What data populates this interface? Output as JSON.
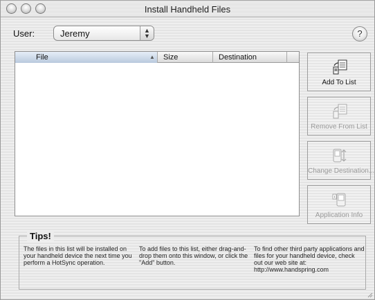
{
  "window": {
    "title": "Install Handheld Files"
  },
  "user": {
    "label": "User:",
    "value": "Jeremy"
  },
  "help": {
    "label": "?"
  },
  "table": {
    "columns": [
      "File",
      "Size",
      "Destination"
    ],
    "sort_indicator": "▲",
    "rows": []
  },
  "buttons": [
    {
      "label": "Add To List",
      "enabled": true,
      "icon": "add-file-icon"
    },
    {
      "label": "Remove From List",
      "enabled": false,
      "icon": "remove-file-icon"
    },
    {
      "label": "Change Destination...",
      "enabled": false,
      "icon": "change-destination-icon"
    },
    {
      "label": "Application Info",
      "enabled": false,
      "icon": "application-info-icon"
    }
  ],
  "tips": {
    "title": "Tips!",
    "items": [
      "The files in this list will be installed on your handheld device the next time you perform a HotSync operation.",
      "To add files to this list, either drag-and-drop them onto this window, or click the \"Add\" button.",
      "To find other third party applications and files for your handheld device, check out our web site at: http://www.handspring.com"
    ]
  }
}
